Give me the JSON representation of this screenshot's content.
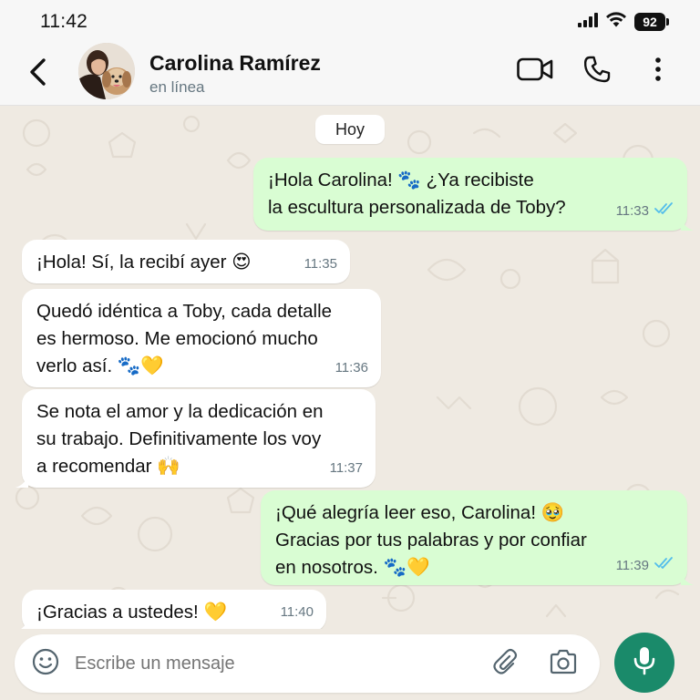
{
  "status_bar": {
    "time": "11:42",
    "battery": "92",
    "icons": [
      "signal-icon",
      "wifi-icon",
      "battery-icon"
    ]
  },
  "header": {
    "contact_name": "Carolina Ramírez",
    "contact_status": "en línea",
    "icons": [
      "back-arrow-icon",
      "video-call-icon",
      "phone-icon",
      "more-vert-icon"
    ]
  },
  "chat": {
    "date_chip": "Hoy",
    "messages": [
      {
        "direction": "out",
        "text": "¡Hola Carolina! 🐾 ¿Ya recibiste\nla escultura personalizada de Toby?",
        "time": "11:33",
        "read": true
      },
      {
        "direction": "in",
        "text": "¡Hola! Sí, la recibí ayer 😍",
        "time": "11:35"
      },
      {
        "direction": "in",
        "text": "Quedó idéntica a Toby, cada detalle\nes hermoso. Me emocionó mucho\nverlo así. 🐾💛",
        "time": "11:36"
      },
      {
        "direction": "in",
        "text": "Se nota el amor y la dedicación en\nsu trabajo. Definitivamente los voy\na recomendar 🙌",
        "time": "11:37"
      },
      {
        "direction": "out",
        "text": "¡Qué alegría leer eso, Carolina! 🥹\nGracias por tus palabras y por confiar\nen nosotros. 🐾💛",
        "time": "11:39",
        "read": true
      },
      {
        "direction": "in",
        "text": "¡Gracias a ustedes! 💛",
        "time": "11:40"
      }
    ]
  },
  "input": {
    "placeholder": "Escribe un mensaje",
    "icons": [
      "emoji-icon",
      "attach-icon",
      "camera-icon",
      "mic-icon"
    ]
  },
  "colors": {
    "chat_background": "#efeae2",
    "outgoing_bubble": "#d9fdd3",
    "incoming_bubble": "#ffffff",
    "read_ticks": "#53bdeb",
    "mic_button": "#1a8a6a"
  }
}
